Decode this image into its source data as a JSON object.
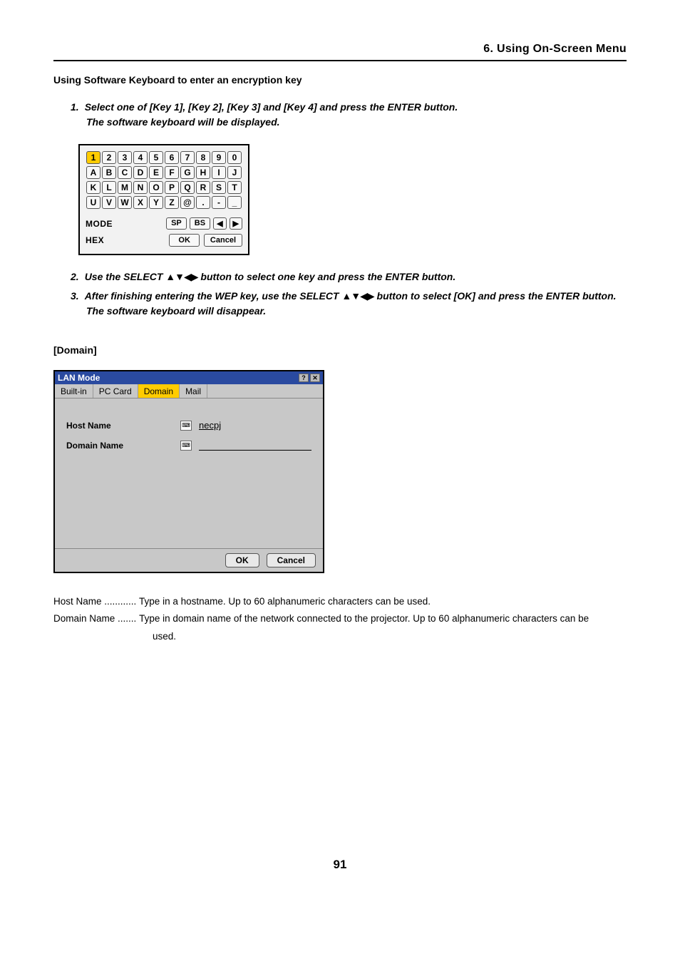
{
  "header": {
    "section_title": "6. Using On-Screen Menu"
  },
  "subheading": "Using Software Keyboard to enter an encryption key",
  "steps": {
    "s1_num": "1.",
    "s1_text": "Select one of [Key 1], [Key 2], [Key 3] and [Key 4] and press the ENTER button.",
    "s1_sub": "The software keyboard will be displayed.",
    "s2_num": "2.",
    "s2_pre": "Use the SELECT ",
    "s2_arrows": "▲▼◀▶",
    "s2_post": " button to select one key and press the ENTER button.",
    "s3_num": "3.",
    "s3_pre": "After finishing entering the WEP key, use the SELECT ",
    "s3_arrows": "▲▼◀▶",
    "s3_post": " button to select [OK] and press the ENTER button.",
    "s3_sub": "The software keyboard will disappear."
  },
  "keyboard": {
    "row1": [
      "1",
      "2",
      "3",
      "4",
      "5",
      "6",
      "7",
      "8",
      "9",
      "0"
    ],
    "row2": [
      "A",
      "B",
      "C",
      "D",
      "E",
      "F",
      "G",
      "H",
      "I",
      "J"
    ],
    "row3": [
      "K",
      "L",
      "M",
      "N",
      "O",
      "P",
      "Q",
      "R",
      "S",
      "T"
    ],
    "row4": [
      "U",
      "V",
      "W",
      "X",
      "Y",
      "Z",
      "@",
      ".",
      "-",
      "_"
    ],
    "mode_label": "MODE",
    "hex_label": "HEX",
    "sp_label": "SP",
    "bs_label": "BS",
    "left_icon": "◀",
    "right_icon": "▶",
    "ok_label": "OK",
    "cancel_label": "Cancel"
  },
  "domain": {
    "heading": "[Domain]",
    "window_title": "LAN Mode",
    "help_icon": "?",
    "close_icon": "✕",
    "tabs": {
      "builtin": "Built-in",
      "pccard": "PC Card",
      "domain": "Domain",
      "mail": "Mail"
    },
    "host_label": "Host Name",
    "host_value": "necpj",
    "domain_label": "Domain Name",
    "domain_value": "",
    "ok_label": "OK",
    "cancel_label": "Cancel"
  },
  "definitions": {
    "host_term": "Host Name ............",
    "host_desc": "Type in a hostname. Up to 60 alphanumeric characters can be used.",
    "domain_term": "Domain Name .......",
    "domain_desc": "Type in domain name of the network connected to the projector. Up to 60 alphanumeric characters can be",
    "domain_desc2": "used."
  },
  "page_number": "91"
}
